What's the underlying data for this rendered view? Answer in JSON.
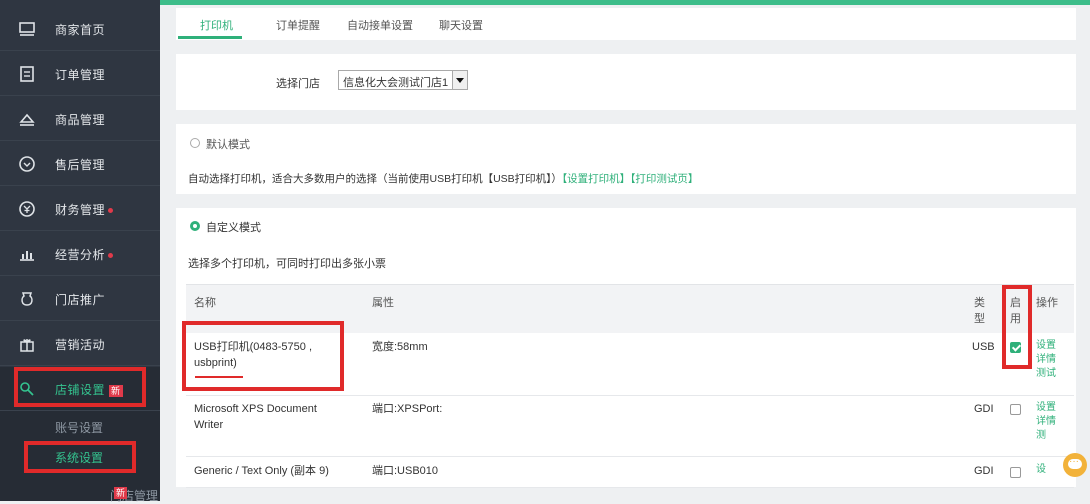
{
  "sidebar": {
    "items": [
      {
        "label": "商家首页",
        "icon": "store-icon"
      },
      {
        "label": "订单管理",
        "icon": "document-icon"
      },
      {
        "label": "商品管理",
        "icon": "product-icon"
      },
      {
        "label": "售后管理",
        "icon": "service-icon"
      },
      {
        "label": "财务管理",
        "icon": "finance-icon",
        "dot": true
      },
      {
        "label": "经营分析",
        "icon": "chart-icon",
        "dot": true
      },
      {
        "label": "门店推广",
        "icon": "promo-icon"
      },
      {
        "label": "营销活动",
        "icon": "gift-icon"
      },
      {
        "label": "店铺设置",
        "icon": "settings-icon",
        "badge": "新"
      }
    ],
    "sub_items": [
      {
        "label": "账号设置"
      },
      {
        "label": "系统设置"
      },
      {
        "label": "门店管理",
        "badge": "新"
      }
    ]
  },
  "tabs": [
    {
      "label": "打印机"
    },
    {
      "label": "订单提醒"
    },
    {
      "label": "自动接单设置"
    },
    {
      "label": "聊天设置"
    }
  ],
  "store": {
    "label": "选择门店",
    "selected": "信息化大会测试门店1"
  },
  "default_mode": {
    "label": "默认模式",
    "description": "自动选择打印机，适合大多数用户的选择（当前使用USB打印机【USB打印机】）",
    "link_set": "【设置打印机】",
    "link_test": "【打印测试页】"
  },
  "custom_mode": {
    "label": "自定义模式",
    "description": "选择多个打印机，可同时打印出多张小票"
  },
  "table": {
    "headers": {
      "name": "名称",
      "attr": "属性",
      "type_1": "类",
      "type_2": "型",
      "enable_1": "启",
      "enable_2": "用",
      "op": "操作"
    },
    "rows": [
      {
        "name_1": "USB打印机(0483-5750 ,",
        "name_2": "usbprint)",
        "attr": "宽度:58mm",
        "type": "USB",
        "enabled": true,
        "ops": [
          "设置",
          "详情",
          "测试"
        ]
      },
      {
        "name_1": "Microsoft XPS Document",
        "name_2": "Writer",
        "attr": "端口:XPSPort:",
        "type": "GDI",
        "enabled": false,
        "ops": [
          "设置",
          "详情",
          "测"
        ]
      },
      {
        "name_1": "Generic / Text Only (副本 9)",
        "name_2": "",
        "attr": "端口:USB010",
        "type": "GDI",
        "enabled": false,
        "ops": [
          "设"
        ]
      }
    ]
  },
  "colors": {
    "accent": "#2fb07a",
    "highlight": "#e02a2a",
    "sidebar": "#2f3641"
  }
}
